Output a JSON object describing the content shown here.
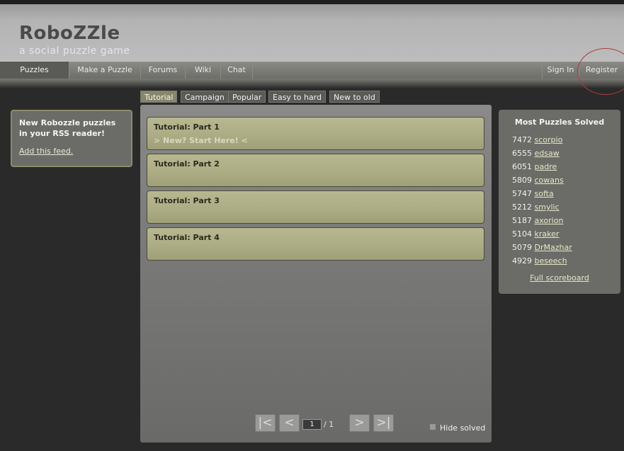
{
  "header": {
    "title": "RoboZZle",
    "subtitle": "a social puzzle game"
  },
  "nav": {
    "items": [
      {
        "label": "Puzzles",
        "active": true
      },
      {
        "label": "Make a Puzzle"
      },
      {
        "label": "Forums"
      },
      {
        "label": "Wiki"
      },
      {
        "label": "Chat"
      }
    ],
    "sign_in": "Sign In",
    "register": "Register"
  },
  "tabs": [
    {
      "label": "Tutorial",
      "active": true
    },
    {
      "label": "Campaign"
    },
    {
      "label": "Popular"
    },
    {
      "label": "Easy to hard"
    },
    {
      "label": "New to old"
    }
  ],
  "rss": {
    "title": "New Robozzle puzzles in your RSS reader!",
    "link": "Add this feed."
  },
  "puzzles": [
    {
      "title": "Tutorial: Part 1",
      "subtitle": "> New? Start Here! <"
    },
    {
      "title": "Tutorial: Part 2",
      "subtitle": ""
    },
    {
      "title": "Tutorial: Part 3",
      "subtitle": ""
    },
    {
      "title": "Tutorial: Part 4",
      "subtitle": ""
    }
  ],
  "pager": {
    "first": "|<",
    "prev": "<",
    "next": ">",
    "last": ">|",
    "current_page": "1",
    "total": "/ 1",
    "hide_solved_label": "Hide solved"
  },
  "scoreboard": {
    "title": "Most Puzzles Solved",
    "entries": [
      {
        "count": "7472",
        "name": "scorpio"
      },
      {
        "count": "6555",
        "name": "edsaw"
      },
      {
        "count": "6051",
        "name": "padre"
      },
      {
        "count": "5809",
        "name": "cowans"
      },
      {
        "count": "5747",
        "name": "softa"
      },
      {
        "count": "5212",
        "name": "smylic"
      },
      {
        "count": "5187",
        "name": "axorion"
      },
      {
        "count": "5104",
        "name": "kraker"
      },
      {
        "count": "5079",
        "name": "DrMazhar"
      },
      {
        "count": "4929",
        "name": "beseech"
      }
    ],
    "full_link": "Full scoreboard"
  },
  "colors": {
    "annotation_circle": "#b23a3a",
    "puzzle_card": "#aeae86",
    "accent_link": "#e8e8c8"
  }
}
